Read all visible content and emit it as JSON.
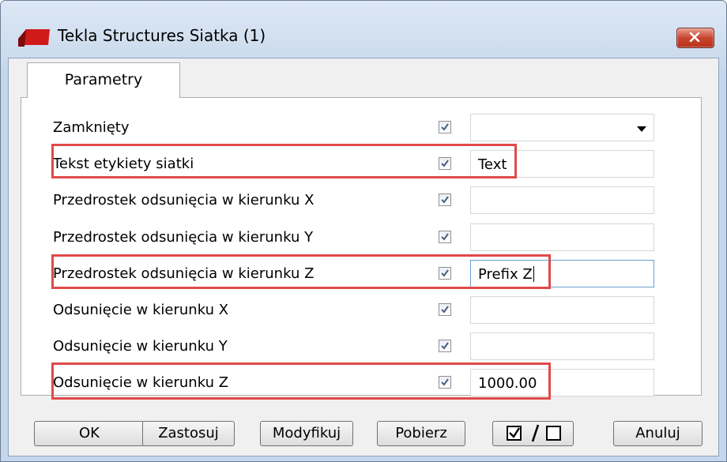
{
  "window": {
    "title": "Tekla Structures  Siatka (1)",
    "app_icon": "tekla-logo-icon",
    "close_icon": "close-icon"
  },
  "tabs": [
    {
      "label": "Parametry",
      "selected": true
    }
  ],
  "rows": [
    {
      "label": "Zamknięty",
      "checked": true,
      "value": "",
      "type": "dropdown",
      "highlighted": false
    },
    {
      "label": "Tekst etykiety siatki",
      "checked": true,
      "value": "Text",
      "type": "text",
      "highlighted": true
    },
    {
      "label": "Przedrostek odsunięcia w kierunku X",
      "checked": true,
      "value": "",
      "type": "text",
      "highlighted": false
    },
    {
      "label": "Przedrostek odsunięcia w kierunku Y",
      "checked": true,
      "value": "",
      "type": "text",
      "highlighted": false
    },
    {
      "label": "Przedrostek odsunięcia w kierunku Z",
      "checked": true,
      "value": "Prefix Z",
      "type": "text",
      "highlighted": true,
      "focused": true
    },
    {
      "label": "Odsunięcie w kierunku X",
      "checked": true,
      "value": "",
      "type": "text",
      "highlighted": false
    },
    {
      "label": "Odsunięcie w kierunku Y",
      "checked": true,
      "value": "",
      "type": "text",
      "highlighted": false
    },
    {
      "label": "Odsunięcie w kierunku Z",
      "checked": true,
      "value": "1000.00",
      "type": "text",
      "highlighted": true
    }
  ],
  "buttons": {
    "ok": "OK",
    "apply": "Zastosuj",
    "modify": "Modyfikuj",
    "get": "Pobierz",
    "toggle_all": "check-uncheck-icon",
    "cancel": "Anuluj"
  },
  "colors": {
    "highlight": "#e04a4a",
    "title_bar": "#c8d9ec",
    "close_button": "#c9452f",
    "checkbox_check": "#4a5f7d"
  }
}
